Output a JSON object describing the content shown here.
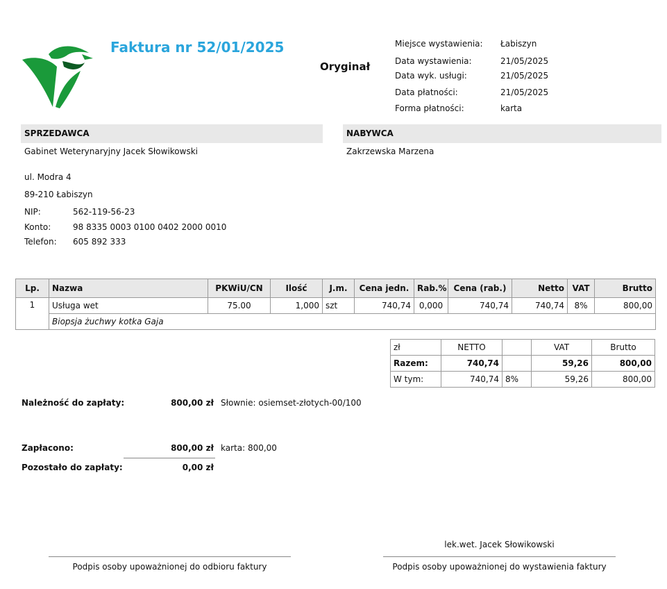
{
  "header": {
    "title": "Faktura nr 52/01/2025",
    "status": "Oryginał",
    "logo_colors": {
      "green": "#1a9a3a",
      "dark": "#0c5a22"
    },
    "meta": [
      {
        "label": "Miejsce wystawienia:",
        "value": "Łabiszyn"
      },
      {
        "label": "Data wystawienia:",
        "value": "21/05/2025"
      },
      {
        "label": "Data wyk. usługi:",
        "value": "21/05/2025"
      },
      {
        "label": "Data płatności:",
        "value": "21/05/2025"
      },
      {
        "label": "Forma płatności:",
        "value": "karta"
      }
    ]
  },
  "seller": {
    "heading": "SPRZEDAWCA",
    "name": "Gabinet Weterynaryjny Jacek Słowikowski",
    "street": "ul. Modra 4",
    "city": "89-210 Łabiszyn",
    "nip_label": "NIP:",
    "nip": "562-119-56-23",
    "account_label": "Konto:",
    "account": "98 8335 0003 0100 0402 2000 0010",
    "phone_label": "Telefon:",
    "phone": "605 892 333"
  },
  "buyer": {
    "heading": "NABYWCA",
    "name": "Zakrzewska Marzena"
  },
  "items": {
    "columns": [
      "Lp.",
      "Nazwa",
      "PKWiU/CN",
      "Ilość",
      "J.m.",
      "Cena jedn.",
      "Rab.%",
      "Cena (rab.)",
      "Netto",
      "VAT",
      "Brutto"
    ],
    "rows": [
      {
        "lp": "1",
        "name": "Usługa wet",
        "pkwiu": "75.00",
        "qty": "1,000",
        "unit": "szt",
        "unit_price": "740,74",
        "discount": "0,000",
        "price_disc": "740,74",
        "net": "740,74",
        "vat": "8%",
        "gross": "800,00",
        "description": "Biopsja żuchwy kotka Gaja"
      }
    ]
  },
  "summary": {
    "headers": [
      "zł",
      "NETTO",
      "",
      "VAT",
      "Brutto"
    ],
    "total": {
      "label": "Razem:",
      "net": "740,74",
      "rate": "",
      "vat": "59,26",
      "gross": "800,00"
    },
    "breakdown": {
      "label": "W tym:",
      "net": "740,74",
      "rate": "8%",
      "vat": "59,26",
      "gross": "800,00"
    }
  },
  "payment": {
    "due_label": "Należność do zapłaty:",
    "due_amount": "800,00 zł",
    "due_words": "Słownie: osiemset-złotych-00/100",
    "paid_label": "Zapłacono:",
    "paid_amount": "800,00 zł",
    "paid_note": "karta: 800,00",
    "remaining_label": "Pozostało do zapłaty:",
    "remaining_amount": "0,00 zł"
  },
  "signatures": {
    "issuer_name": "lek.wet. Jacek Słowikowski",
    "receiver_caption": "Podpis osoby upoważnionej do odbioru faktury",
    "issuer_caption": "Podpis osoby upoważnionej do wystawienia faktury"
  }
}
